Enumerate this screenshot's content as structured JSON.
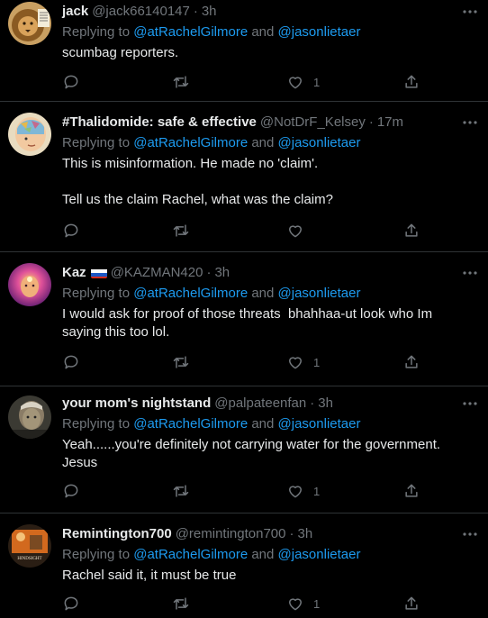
{
  "tweets": [
    {
      "name": "jack",
      "handle": "@jack66140147",
      "sep": "·",
      "time": "3h",
      "replying_prefix": "Replying to ",
      "mention1": "@atRachelGilmore",
      "and": " and ",
      "mention2": "@jasonlietaer",
      "text": "scumbag reporters.",
      "likes": "1"
    },
    {
      "name": "#Thalidomide: safe & effective",
      "handle": "@NotDrF_Kelsey",
      "sep": "·",
      "time": "17m",
      "replying_prefix": "Replying to ",
      "mention1": "@atRachelGilmore",
      "and": " and ",
      "mention2": "@jasonlietaer",
      "text": "This is misinformation. He made no 'claim'.\n\nTell us the claim Rachel, what was the claim?",
      "likes": ""
    },
    {
      "name": "Kaz",
      "handle": "@KAZMAN420",
      "sep": "·",
      "time": "3h",
      "replying_prefix": "Replying to ",
      "mention1": "@atRachelGilmore",
      "and": " and ",
      "mention2": "@jasonlietaer",
      "text": "I would ask for proof of those threats  bhahhaa-ut look who Im saying this too lol.",
      "likes": "1"
    },
    {
      "name": "your mom's nightstand",
      "handle": "@palpateenfan",
      "sep": "·",
      "time": "3h",
      "replying_prefix": "Replying to ",
      "mention1": "@atRachelGilmore",
      "and": " and ",
      "mention2": "@jasonlietaer",
      "text": "Yeah......you're definitely not carrying water for the government. Jesus",
      "likes": "1"
    },
    {
      "name": "Remintington700",
      "handle": "@remintington700",
      "sep": "·",
      "time": "3h",
      "replying_prefix": "Replying to ",
      "mention1": "@atRachelGilmore",
      "and": " and ",
      "mention2": "@jasonlietaer",
      "text": "Rachel said it, it must be true",
      "likes": "1",
      "avatar_caption": "HINDSIGHT"
    }
  ],
  "icons": {
    "more": "more-horizontal-icon",
    "reply": "reply-icon",
    "retweet": "retweet-icon",
    "like": "heart-icon",
    "share": "share-icon",
    "flag": "russia-flag-icon"
  },
  "colors": {
    "background": "#000000",
    "text": "#e7e9ea",
    "muted": "#71767b",
    "link": "#1d9bf0",
    "divider": "#2f3336"
  }
}
